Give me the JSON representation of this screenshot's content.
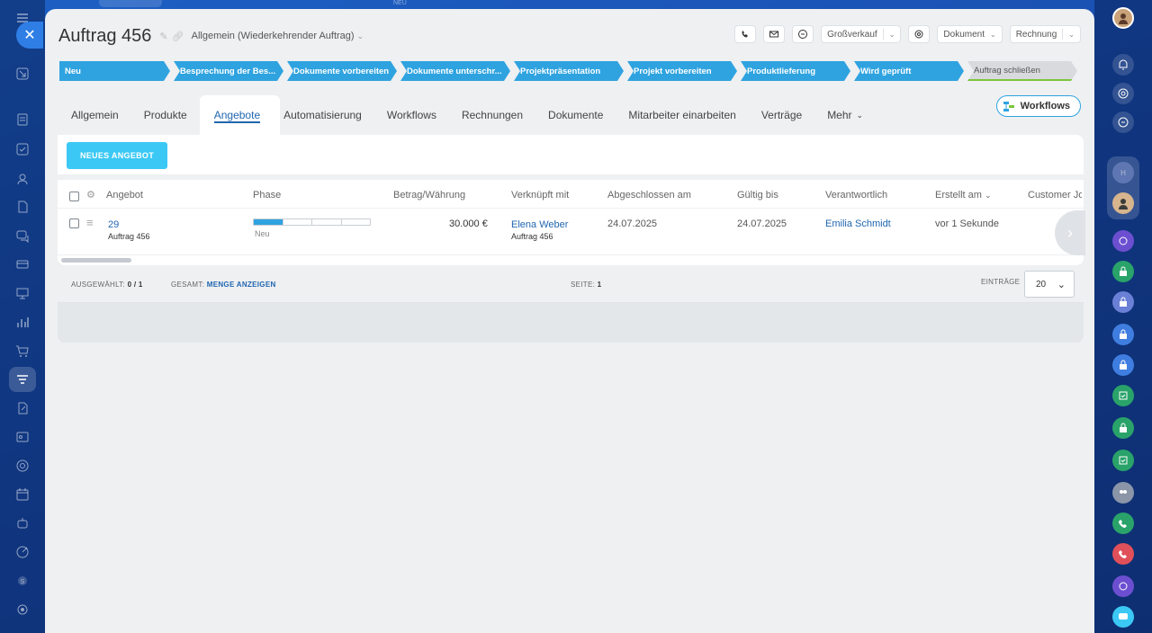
{
  "header": {
    "title": "Auftrag 456",
    "category": "Allgemein (Wiederkehrender Auftrag)",
    "tools": {
      "grossverkauf": "Großverkauf",
      "dokument": "Dokument",
      "rechnung": "Rechnung"
    }
  },
  "stages": [
    {
      "label": "Neu"
    },
    {
      "label": "Besprechung der Bes..."
    },
    {
      "label": "Dokumente vorbereiten"
    },
    {
      "label": "Dokumente unterschr..."
    },
    {
      "label": "Projektpräsentation"
    },
    {
      "label": "Projekt vorbereiten"
    },
    {
      "label": "Produktlieferung"
    },
    {
      "label": "Wird geprüft"
    },
    {
      "label": "Auftrag schließen"
    }
  ],
  "tabs": [
    {
      "label": "Allgemein"
    },
    {
      "label": "Produkte"
    },
    {
      "label": "Angebote"
    },
    {
      "label": "Automatisierung"
    },
    {
      "label": "Workflows"
    },
    {
      "label": "Rechnungen"
    },
    {
      "label": "Dokumente"
    },
    {
      "label": "Mitarbeiter einarbeiten"
    },
    {
      "label": "Verträge"
    },
    {
      "label": "Mehr"
    }
  ],
  "workflows_button": "Workflows",
  "list": {
    "new_button": "NEUES ANGEBOT",
    "columns": {
      "angebot": "Angebot",
      "phase": "Phase",
      "betrag": "Betrag/Währung",
      "verknuepft": "Verknüpft mit",
      "abgeschlossen": "Abgeschlossen am",
      "gueltig": "Gültig bis",
      "verantwortlich": "Verantwortlich",
      "erstellt": "Erstellt am",
      "customer": "Customer Jo"
    },
    "rows": [
      {
        "id": "29",
        "subtitle": "Auftrag 456",
        "phase_label": "Neu",
        "phase_progress": 0.25,
        "betrag": "30.000 €",
        "verknuepft_name": "Elena Weber",
        "verknuepft_sub": "Auftrag 456",
        "abgeschlossen": "24.07.2025",
        "gueltig": "24.07.2025",
        "verantwortlich": "Emilia Schmidt",
        "erstellt": "vor 1 Sekunde"
      }
    ]
  },
  "footer": {
    "selected_label": "AUSGEWÄHLT:",
    "selected_value": "0 / 1",
    "total_label": "GESAMT:",
    "total_link": "MENGE ANZEIGEN",
    "page_label": "SEITE:",
    "page_value": "1",
    "entries_label": "EINTRÄGE",
    "entries_value": "20"
  },
  "top_strip": "NEU",
  "colors": {
    "accent": "#2fa3e0",
    "button": "#3bc8f5",
    "link": "#2066b0",
    "background": "#1a4fb0"
  }
}
